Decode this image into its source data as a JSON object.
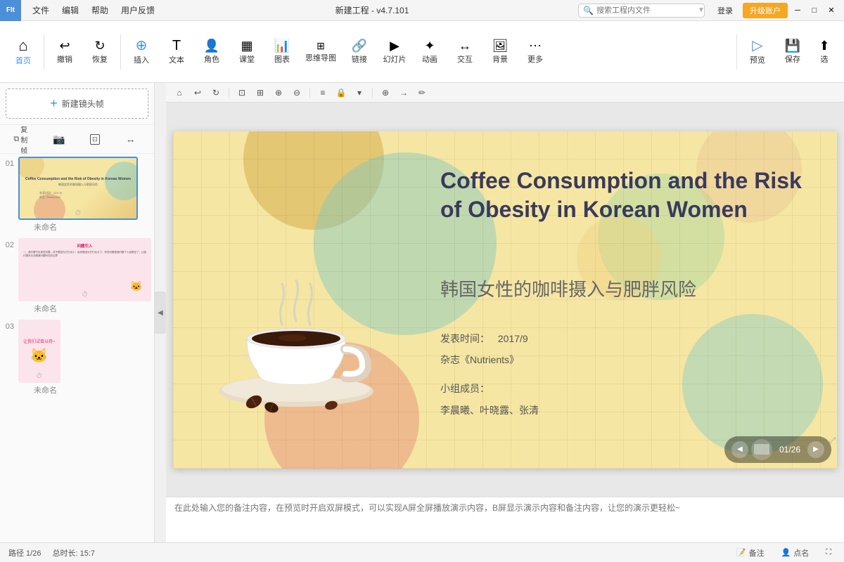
{
  "titlebar": {
    "app_icon": "FIt",
    "menus": [
      "文件",
      "编辑",
      "帮助",
      "用户反馈"
    ],
    "title": "新建工程 - v4.7.101",
    "search_placeholder": "搜索工程内文件",
    "login_label": "登录",
    "upgrade_label": "升级账户",
    "win_minimize": "─",
    "win_maximize": "□",
    "win_close": "✕"
  },
  "toolbar": {
    "groups": [
      {
        "icon": "⌂",
        "label": "首页"
      },
      {
        "icon": "↩",
        "label": "撤销"
      },
      {
        "icon": "↻",
        "label": "恢复"
      },
      {
        "icon": "＋",
        "label": "插入"
      },
      {
        "icon": "T",
        "label": "文本"
      },
      {
        "icon": "👤",
        "label": "角色"
      },
      {
        "icon": "▦",
        "label": "课堂"
      },
      {
        "icon": "📊",
        "label": "图表"
      },
      {
        "icon": "⊞",
        "label": "思维导图"
      },
      {
        "icon": "🔗",
        "label": "链接"
      },
      {
        "icon": "▶",
        "label": "幻灯片"
      },
      {
        "icon": "✦",
        "label": "动画"
      },
      {
        "icon": "↔",
        "label": "交互"
      },
      {
        "icon": "🖼",
        "label": "背景"
      },
      {
        "icon": "…",
        "label": "更多"
      },
      {
        "icon": "▷",
        "label": "预览"
      },
      {
        "icon": "💾",
        "label": "保存"
      },
      {
        "icon": "⬆",
        "label": "选"
      }
    ]
  },
  "sidebar": {
    "add_frame_label": "新建镜头帧",
    "tools": [
      "复制帧",
      "📷",
      "⊡",
      "↔"
    ],
    "slides": [
      {
        "number": "01",
        "name": "未命名",
        "active": true,
        "title_en": "Coffee Consumption and the Risk of Obesity in Korean Women",
        "title_cn": "韩国女性的咖啡摄入与肥胖风险"
      },
      {
        "number": "02",
        "name": "未命名",
        "active": false,
        "title_cn": "问题引入"
      },
      {
        "number": "03",
        "name": "未命名",
        "active": false,
        "title_cn": "让我们试目以待~"
      }
    ]
  },
  "slide": {
    "title_en": "Coffee Consumption and the Risk of Obesity in Korean Women",
    "title_cn": "韩国女性的咖啡摄入与肥胖风险",
    "publish_time_label": "发表时间：",
    "publish_time": "2017/9",
    "journal_label": "杂志《Nutrients》",
    "team_label": "小组成员：",
    "team_members": "李晨曦、叶晓露、张清"
  },
  "canvas_toolbar": {
    "tools": [
      "⌂",
      "↩",
      "↻",
      "⊡",
      "⊞",
      "⊕",
      "⊖",
      "≡",
      "🔒",
      "🖼",
      "⊕",
      "→",
      "✏"
    ]
  },
  "navigation": {
    "prev": "◀",
    "page_info": "01/26",
    "next": "▶"
  },
  "notes": {
    "placeholder": "在此处输入您的备注内容，在预览时开启双屏模式，可以实现A屏全屏播放演示内容，B屏显示演示内容和备注内容，让您的演示更轻松~"
  },
  "statusbar": {
    "page_info": "路径 1/26",
    "duration": "总时长: 15:7",
    "notes_label": "备注",
    "pointer_label": "点名"
  }
}
